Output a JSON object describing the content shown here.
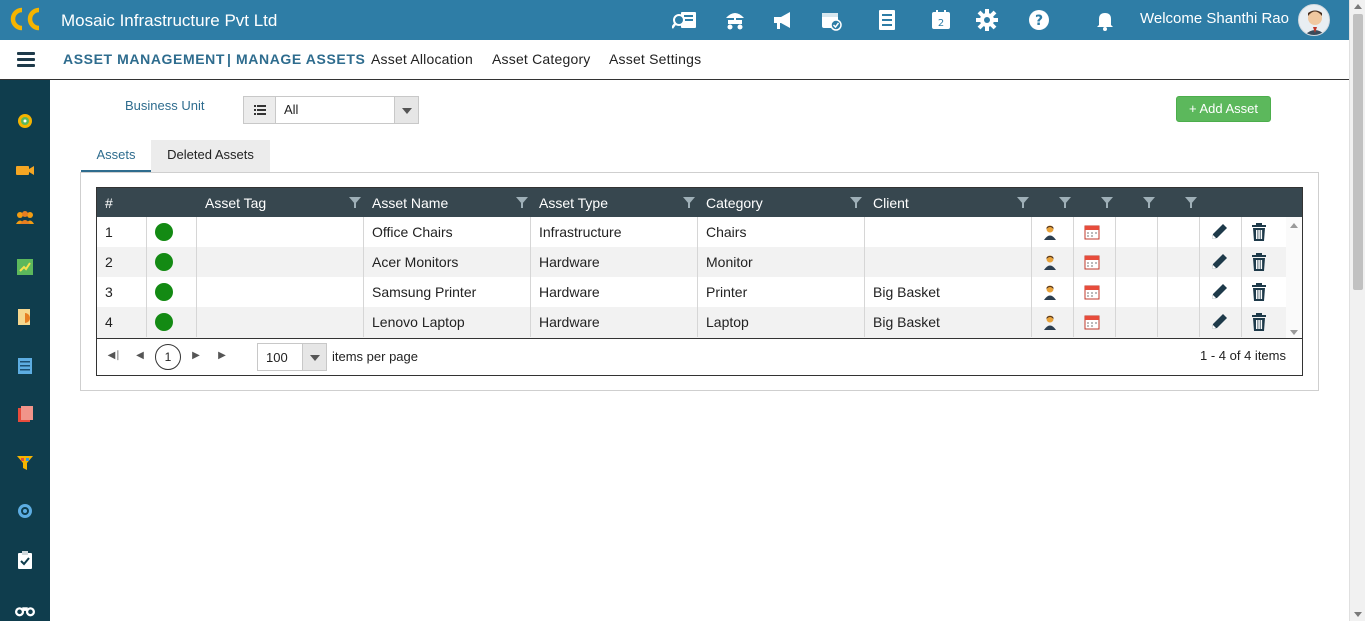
{
  "header": {
    "company": "Mosaic Infrastructure Pvt Ltd",
    "welcome": "Welcome Shanthi Rao",
    "icons": [
      "search-users-icon",
      "travel-icon",
      "announcement-icon",
      "calendar-check-icon",
      "checklist-icon",
      "calendar-icon",
      "gear-icon",
      "help-icon",
      "bell-icon"
    ]
  },
  "subnav": {
    "module": "ASSET MANAGEMENT",
    "current": "| MANAGE ASSETS",
    "items": [
      "Asset Allocation",
      "Asset Category",
      "Asset Settings"
    ]
  },
  "sidebar": {
    "icons": [
      "dashboard-icon",
      "video-icon",
      "team-icon",
      "tasks-icon",
      "document-icon",
      "notes-icon",
      "books-icon",
      "funnel-icon",
      "target-icon",
      "clipboard-icon",
      "binoculars-icon"
    ]
  },
  "filters": {
    "business_unit_label": "Business Unit",
    "business_unit_value": "All"
  },
  "actions": {
    "add_asset": "+ Add Asset"
  },
  "tabs": [
    "Assets",
    "Deleted Assets"
  ],
  "grid": {
    "columns": [
      "#",
      "Asset Tag",
      "Asset Name",
      "Asset Type",
      "Category",
      "Client"
    ],
    "rows": [
      {
        "num": "1",
        "tag": "",
        "name": "Office Chairs",
        "type": "Infrastructure",
        "category": "Chairs",
        "client": ""
      },
      {
        "num": "2",
        "tag": "",
        "name": "Acer Monitors",
        "type": "Hardware",
        "category": "Monitor",
        "client": ""
      },
      {
        "num": "3",
        "tag": "",
        "name": "Samsung Printer",
        "type": "Hardware",
        "category": "Printer",
        "client": "Big Basket"
      },
      {
        "num": "4",
        "tag": "",
        "name": "Lenovo Laptop",
        "type": "Hardware",
        "category": "Laptop",
        "client": "Big Basket"
      }
    ],
    "status_color": "#138a13"
  },
  "pager": {
    "current_page": "1",
    "page_size": "100",
    "per_page_label": "items per page",
    "info": "1 - 4 of 4 items"
  },
  "colors": {
    "topbar": "#2e7da6",
    "sidebar": "#0f3d4d",
    "grid_header": "#37474f",
    "add_button": "#5cb85c"
  }
}
